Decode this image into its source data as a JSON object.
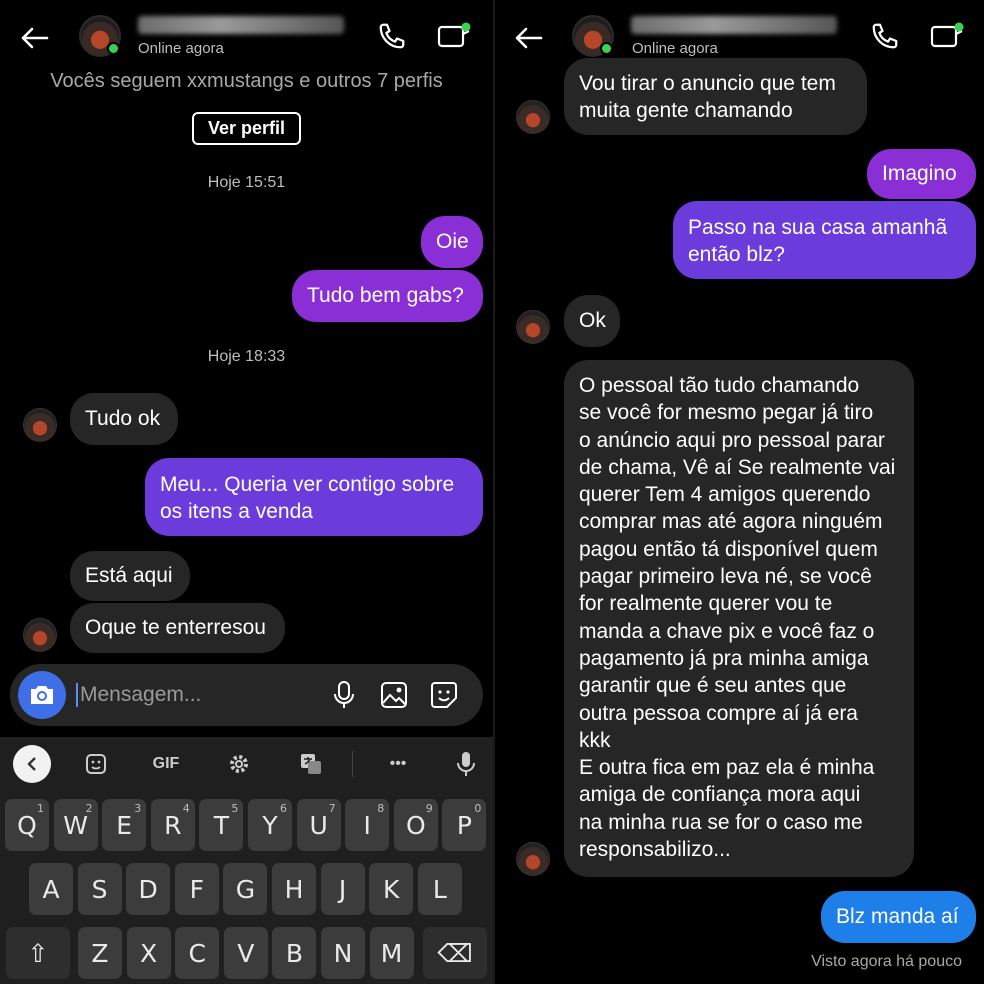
{
  "left": {
    "header": {
      "status": "Online agora"
    },
    "follows_text": "Vocês seguem xxmustangs e outros 7 perfis",
    "view_profile_label": "Ver perfil",
    "timestamps": [
      "Hoje 15:51",
      "Hoje 18:33"
    ],
    "messages": [
      {
        "side": "out",
        "text": "Oie"
      },
      {
        "side": "out",
        "text": "Tudo bem gabs?"
      },
      {
        "side": "in",
        "text": "Tudo ok"
      },
      {
        "side": "out",
        "text": "Meu... Queria ver contigo sobre\nos itens a venda"
      },
      {
        "side": "in",
        "text": "Está aqui"
      },
      {
        "side": "in",
        "text": "Oque te enterresou"
      }
    ],
    "composer": {
      "placeholder": "Mensagem..."
    },
    "keyboard": {
      "toolbar": [
        "back-icon",
        "sticker-icon",
        "GIF",
        "gear-icon",
        "translate-icon",
        "more-icon",
        "mic-icon"
      ],
      "gif_label": "GIF",
      "more_label": "•••",
      "row1": [
        {
          "key": "Q",
          "num": "1"
        },
        {
          "key": "W",
          "num": "2"
        },
        {
          "key": "E",
          "num": "3"
        },
        {
          "key": "R",
          "num": "4"
        },
        {
          "key": "T",
          "num": "5"
        },
        {
          "key": "Y",
          "num": "6"
        },
        {
          "key": "U",
          "num": "7"
        },
        {
          "key": "I",
          "num": "8"
        },
        {
          "key": "O",
          "num": "9"
        },
        {
          "key": "P",
          "num": "0"
        }
      ],
      "row2": [
        "A",
        "S",
        "D",
        "F",
        "G",
        "H",
        "J",
        "K",
        "L"
      ],
      "row3": [
        "Z",
        "X",
        "C",
        "V",
        "B",
        "N",
        "M"
      ],
      "shift_symbol": "⇧",
      "backspace_symbol": "⌫"
    }
  },
  "right": {
    "header": {
      "status": "Online agora"
    },
    "messages": [
      {
        "side": "in",
        "text": "Vou tirar o anuncio que tem\nmuita gente chamando"
      },
      {
        "side": "out",
        "text": "Imagino"
      },
      {
        "side": "out",
        "text": "Passo na sua casa amanhã\nentão blz?"
      },
      {
        "side": "in",
        "text": "Ok"
      },
      {
        "side": "in",
        "text": "O pessoal tão tudo chamando\nse você for mesmo pegar já tiro\no anúncio aqui pro pessoal parar\nde chama, Vê aí Se realmente vai\nquerer Tem 4 amigos querendo\ncomprar mas até agora ninguém\npagou então tá disponível quem\npagar primeiro leva né, se você\nfor realmente querer vou te\nmanda a chave pix e você faz o\npagamento  já pra minha amiga\ngarantir que é seu antes que\noutra pessoa compre aí já era\nkkk\nE outra fica em paz ela é minha\namiga de confiança mora aqui\nna minha rua se for o caso me\nresponsabilizo..."
      },
      {
        "side": "out",
        "text": "Blz manda aí"
      }
    ],
    "seen_text": "Visto agora há pouco"
  },
  "colors": {
    "background": "#000000",
    "incoming_bubble": "#262626",
    "outgoing_purple": "#8a2fd6",
    "outgoing_violet": "#6b3bdc",
    "outgoing_blue": "#1e7fe8",
    "online_dot": "#39d353",
    "camera_button": "#3f6fe6"
  }
}
